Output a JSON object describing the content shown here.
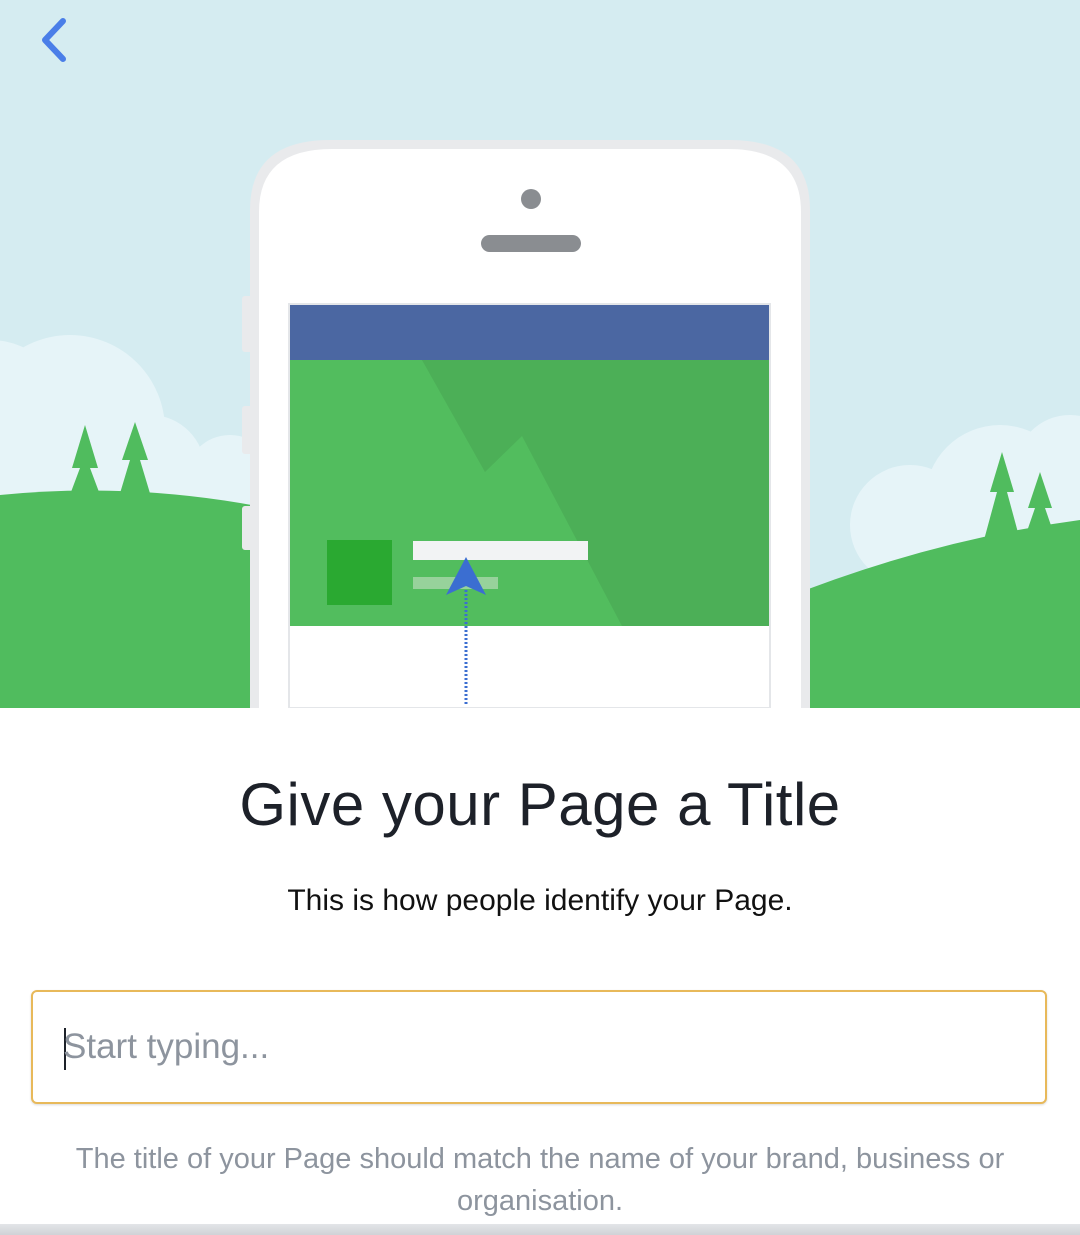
{
  "header": {
    "back_icon": "chevron-left-icon"
  },
  "colors": {
    "sky": "#d5ecf1",
    "cloud": "#e6f4f8",
    "grass": "#50bc5e",
    "tree": "#50bc5e",
    "phone_body": "#ffffff",
    "phone_frame": "#e9eaec",
    "fb_bar": "#4b67a2",
    "cover": "#52bd5e",
    "arrow": "#3b6ed1",
    "input_border": "#e8b95a"
  },
  "main": {
    "title": "Give your Page a Title",
    "subtitle": "This is how people identify your Page."
  },
  "input": {
    "placeholder": "Start typing...",
    "value": ""
  },
  "helper_text": "The title of your Page should match the name of your brand, business or organisation."
}
